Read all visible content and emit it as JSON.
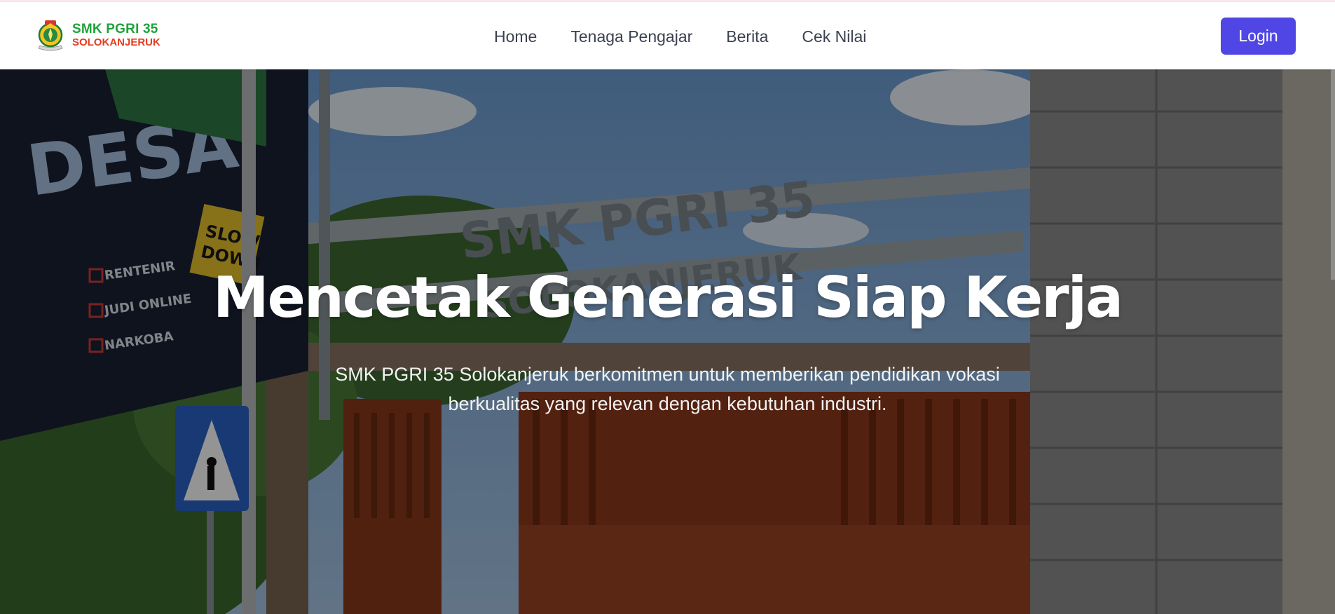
{
  "brand": {
    "name_line1": "SMK PGRI 35",
    "name_line2": "SOLOKANJERUK",
    "colors": {
      "line1": "#1fa23a",
      "line2": "#e53b1e"
    }
  },
  "nav": {
    "links": [
      {
        "label": "Home"
      },
      {
        "label": "Tenaga Pengajar"
      },
      {
        "label": "Berita"
      },
      {
        "label": "Cek Nilai"
      }
    ],
    "login_label": "Login",
    "accent": "#4f46e5"
  },
  "hero": {
    "title": "Mencetak Generasi Siap Kerja",
    "subtitle": "SMK PGRI 35 Solokanjeruk berkomitmen untuk memberikan pendidikan vokasi berkualitas yang relevan dengan kebutuhan industri.",
    "photo_signs": {
      "gate_line1": "SMK PGRI 35",
      "gate_line2": "SOLOKANJERUK",
      "banner_word": "DESA",
      "banner_items": [
        "RENTENIR",
        "JUDI ONLINE",
        "NARKOBA"
      ],
      "slow_sign": [
        "SLOW",
        "DOWN"
      ]
    }
  }
}
